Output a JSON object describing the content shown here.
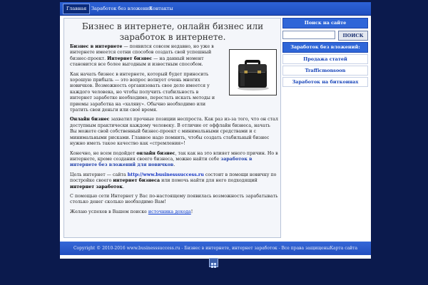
{
  "nav": {
    "items": [
      "Главная",
      "Заработок без вложений",
      "Контакты"
    ]
  },
  "page": {
    "title": "Бизнес в интернете, онлайн бизнес или заработок в интернете."
  },
  "article": {
    "p1_a": "Бизнес в интернете",
    "p1_b": " — появился совсем недавно, но уже в интернете имеется сотни способов создать свой успешный бизнес-проект. ",
    "p1_c": "Интернет бизнес",
    "p1_d": " — на данный момент становится все более выгодным и известным способом.",
    "p2": "Как начать бизнес в интернете, который будет приносить хорошую прибыль — это вопрос волнует очень многих новичков. Возможность организовать свое дело имеется у каждого человека, но чтобы получить стабильность в интернет заработке необходимо, перестать искать методы и приемы заработка на «халяву». Обычно необходимо или тратить свои деньги или своё время.",
    "p3_a": "Онлайн бизнес",
    "p3_b": " захватил прочные позиции неспроста. Как раз из-за того, что он стал доступным практически каждому человеку. В отличие от оффлайн бизнеса, начать Вы можете свой собственный бизнес-проект с минимальными средствами и с минимальными рисками. Главное надо помнить, чтобы создать стабильный бизнес нужно иметь такое качество как «стремления»!",
    "p4_a": "Конечно, не всем подойдет ",
    "p4_b": "онлайн бизнес",
    "p4_c": ", так как на это влияет много причин. Но в интернете, кроме создания своего бизнеса, можно найти себе ",
    "p4_d": "заработок в интернете без вложений для новичков",
    "p4_e": ".",
    "p5_a": "Цель интернет — сайта ",
    "p5_link": "http://www.businesssuccess.ru",
    "p5_b": " состоит в помощи новичку по постройке своего ",
    "p5_c": "интернет бизнеса",
    "p5_d": " или помочь найти для него подходящий ",
    "p5_e": "интернет заработок",
    "p5_f": ".",
    "p6": "С помощью сети Интернет у Вас по-настоящему появилась возможность зарабатывать столько денег сколько необходимо Вам!",
    "p7_a": "Желаю успехов в Вашем поиске ",
    "p7_link": "источника дохода",
    "p7_b": "!"
  },
  "sidebar": {
    "search_title": "Поиск на сайте",
    "search_value": "",
    "search_button": "ПОИСК",
    "links_title": "Заработок без вложений:",
    "links": [
      "Продажа статей",
      "Trafficmonsoon",
      "Заработок на биткоинах"
    ]
  },
  "footer": {
    "text": "Copyright © 2010-2016 www.businesssuccess.ru - Бизнес в интернете, интернет заработок - Все права защищеныКарта сайта"
  },
  "icons": {
    "briefcase": "briefcase-icon",
    "bottom": "grid-icon"
  },
  "colors": {
    "background": "#0b1a4d",
    "nav": "#2d62d6",
    "link": "#0033cc"
  }
}
